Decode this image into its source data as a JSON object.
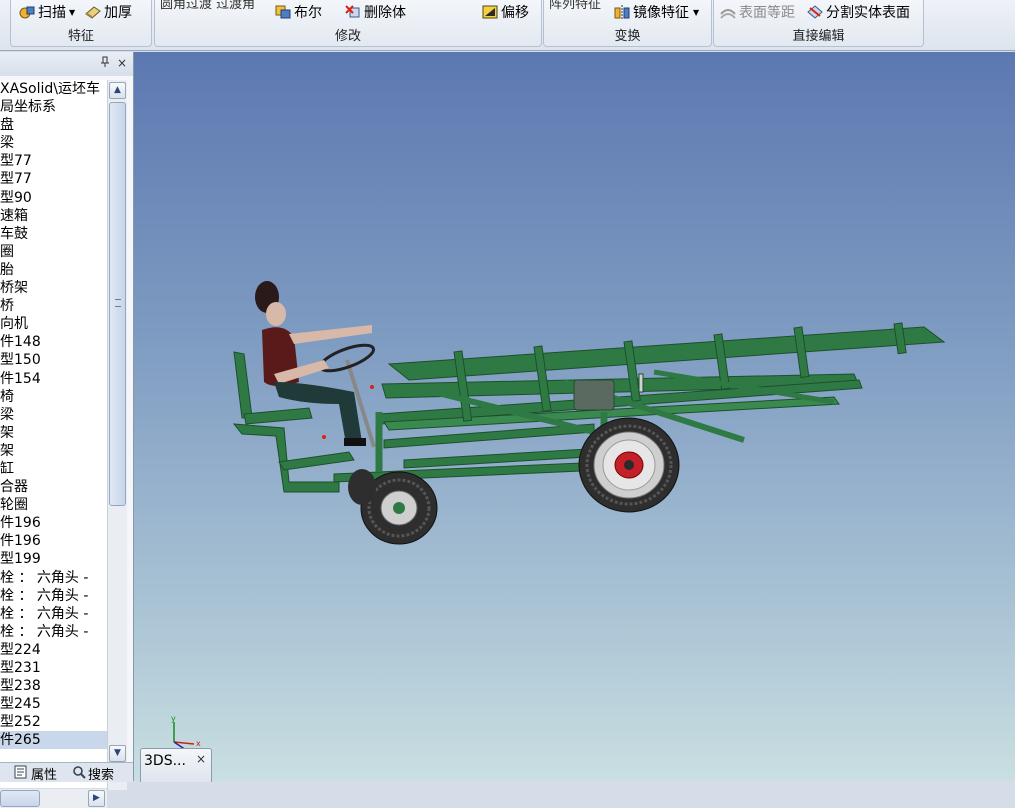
{
  "ribbon": {
    "features_group": {
      "label": "特征",
      "sweep_label": "扫描",
      "thicken_label": "加厚"
    },
    "modify_group": {
      "label": "修改",
      "cut_text": "圆角过渡  过渡角",
      "boolean_label": "布尔",
      "delete_body_label": "删除体",
      "offset_label": "偏移"
    },
    "transform_group": {
      "label": "变换",
      "cut_text": "阵列特征",
      "mirror_label": "镜像特征"
    },
    "direct_edit_group": {
      "label": "直接编辑",
      "surface_offset_label": "表面等距",
      "split_body_label": "分割实体表面"
    }
  },
  "panel": {
    "pin_icon": "pin-icon",
    "close_label": "×",
    "tree_items": [
      "XASolid\\运坯车",
      "局坐标系",
      "盘",
      "梁",
      "型77",
      "型77",
      "型90",
      "速箱",
      "车鼓",
      "圈",
      "胎",
      "桥架",
      "桥",
      "向机",
      "件148",
      "型150",
      "件154",
      "椅",
      "梁",
      "架",
      "架",
      "缸",
      "合器",
      "轮圈",
      "件196",
      "件196",
      "型199",
      "栓 ： 六角头 -",
      "栓 ： 六角头 -",
      "栓 ： 六角头 -",
      "栓 ： 六角头 -",
      "型224",
      "型231",
      "型238",
      "型245",
      "型252",
      "件265"
    ],
    "tabs": {
      "properties_label": "属性",
      "search_label": "搜索"
    }
  },
  "viewport": {
    "doc_tab_label": "3DS...",
    "doc_tab_close": "×",
    "axis_labels": {
      "x": "x",
      "y": "y",
      "z": "z"
    }
  },
  "colors": {
    "frame_green": "#2f7a44",
    "frame_dark": "#1d4f2c",
    "tire": "#3a3a3a",
    "rim": "#cfcfcf",
    "hub_red": "#c4202a",
    "shirt": "#5a1a1a",
    "pants": "#1f3a38",
    "skin": "#d8b8a8"
  }
}
